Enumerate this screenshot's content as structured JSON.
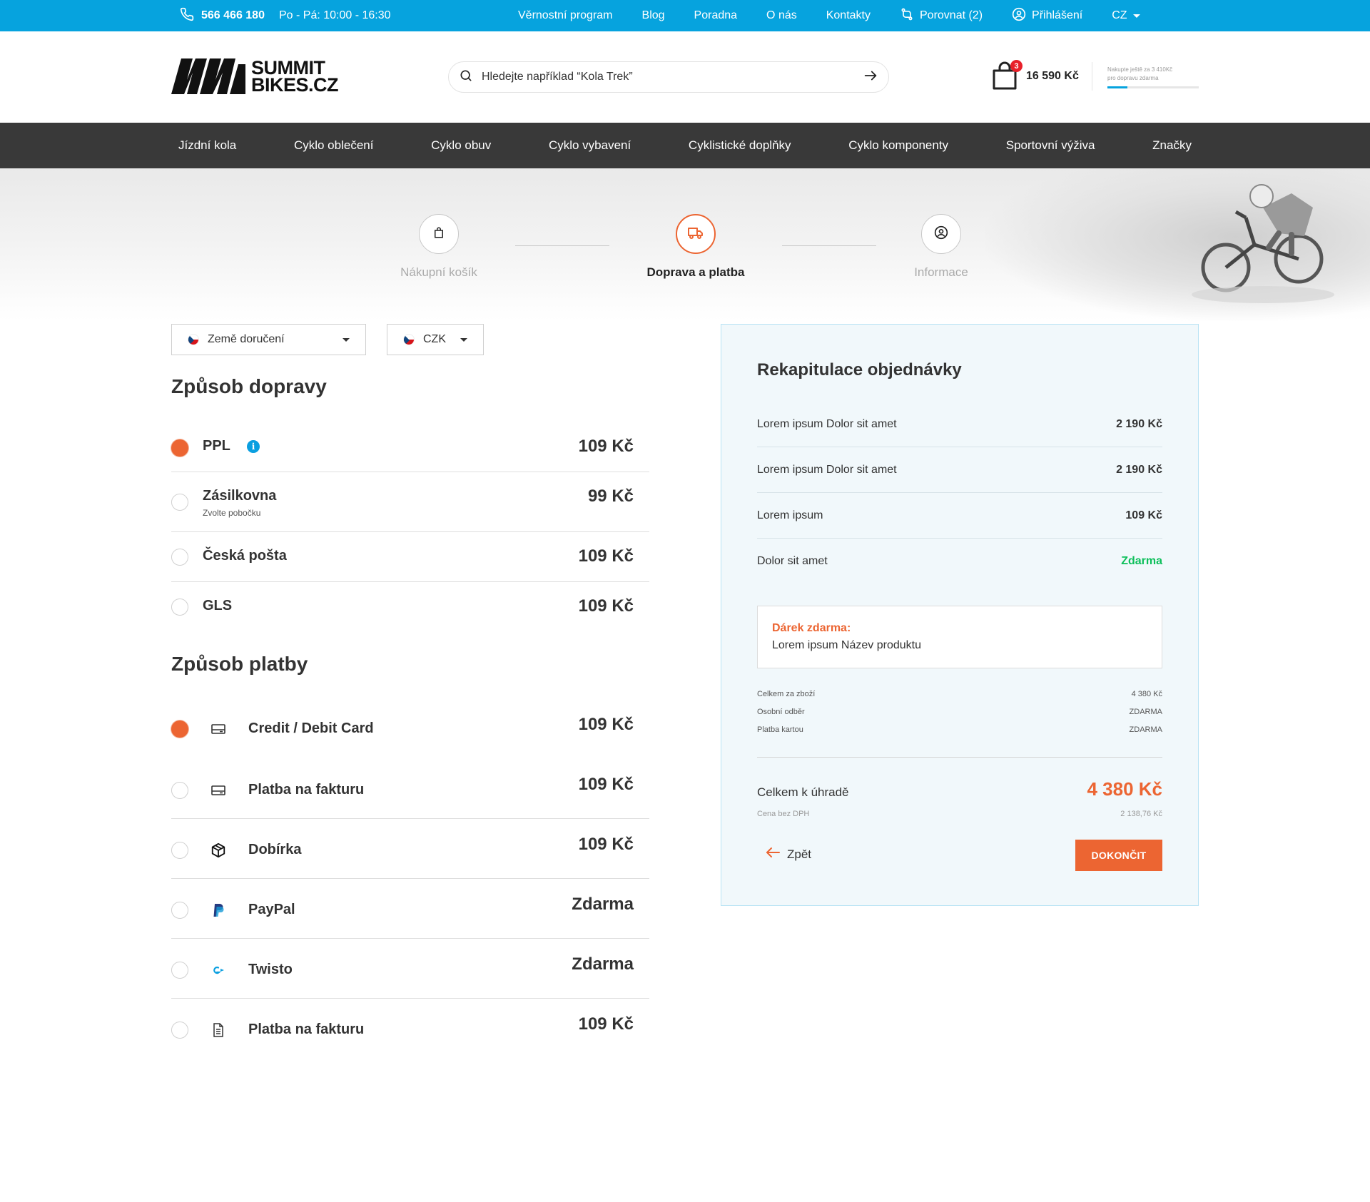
{
  "topbar": {
    "phone": "566 466 180",
    "hours": "Po - Pá: 10:00 - 16:30",
    "links": [
      "Věrnostní program",
      "Blog",
      "Poradna",
      "O nás",
      "Kontakty"
    ],
    "compare_label": "Porovnat (2)",
    "login_label": "Přihlášení",
    "lang": "CZ"
  },
  "header": {
    "logo_line1": "SUMMIT",
    "logo_line2": "BIKES.CZ",
    "search_placeholder": "Hledejte například “Kola Trek”",
    "cart_count": "3",
    "cart_total": "16 590 Kč",
    "freeship_line1": "Nakupte ještě za 3 410Kč",
    "freeship_line2": "pro dopravu zdarma",
    "freeship_progress": 0.22
  },
  "nav": {
    "items": [
      "Jízdní kola",
      "Cyklo oblečení",
      "Cyklo obuv",
      "Cyklo vybavení",
      "Cyklistické doplňky",
      "Cyklo komponenty",
      "Sportovní výživa",
      "Značky"
    ]
  },
  "steps": [
    {
      "label": "Nákupní košík",
      "icon": "bag-icon"
    },
    {
      "label": "Doprava a platba",
      "icon": "truck-icon"
    },
    {
      "label": "Informace",
      "icon": "user-icon"
    }
  ],
  "filters": {
    "country_label": "Země doručení",
    "currency_label": "CZK"
  },
  "shipping": {
    "title": "Způsob dopravy",
    "options": [
      {
        "name": "PPL",
        "sub": "",
        "price": "109 Kč",
        "selected": true
      },
      {
        "name": "Zásilkovna",
        "sub": "Zvolte pobočku",
        "price": "99 Kč",
        "selected": false
      },
      {
        "name": "Česká pošta",
        "sub": "",
        "price": "109 Kč",
        "selected": false
      },
      {
        "name": "GLS",
        "sub": "",
        "price": "109 Kč",
        "selected": false
      }
    ]
  },
  "payment": {
    "title": "Způsob platby",
    "options": [
      {
        "name": "Credit / Debit Card",
        "price": "109 Kč",
        "icon": "card-icon",
        "selected": true
      },
      {
        "name": "Platba na fakturu",
        "price": "109 Kč",
        "icon": "card-icon",
        "selected": false
      },
      {
        "name": "Dobírka",
        "price": "109 Kč",
        "icon": "box-icon",
        "selected": false
      },
      {
        "name": "PayPal",
        "price": "Zdarma",
        "icon": "paypal-icon",
        "selected": false
      },
      {
        "name": "Twisto",
        "price": "Zdarma",
        "icon": "twisto-icon",
        "selected": false
      },
      {
        "name": "Platba na fakturu",
        "price": "109 Kč",
        "icon": "document-icon",
        "selected": false
      }
    ]
  },
  "summary": {
    "title": "Rekapitulace objednávky",
    "items": [
      {
        "name": "Lorem ipsum Dolor sit amet",
        "value": "2 190 Kč"
      },
      {
        "name": "Lorem ipsum Dolor sit amet",
        "value": "2 190 Kč"
      },
      {
        "name": "Lorem ipsum",
        "value": "109 Kč"
      },
      {
        "name": "Dolor sit amet",
        "value": "Zdarma"
      }
    ],
    "gift_title": "Dárek zdarma:",
    "gift_name": "Lorem ipsum Název produktu",
    "breakdown": [
      {
        "label": "Celkem za zboží",
        "value": "4 380 Kč"
      },
      {
        "label": "Osobní odběr",
        "value": "ZDARMA"
      },
      {
        "label": "Platba kartou",
        "value": "ZDARMA"
      }
    ],
    "total_label": "Celkem k úhradě",
    "total_value": "4 380 Kč",
    "vat_label": "Cena bez DPH",
    "vat_value": "2 138,76 Kč",
    "back_label": "Zpět",
    "finish_label": "DOKONČIT"
  },
  "colors": {
    "topbar": "#06a3de",
    "nav": "#393939",
    "accent": "#ec6532",
    "free": "#0dbf5a"
  }
}
